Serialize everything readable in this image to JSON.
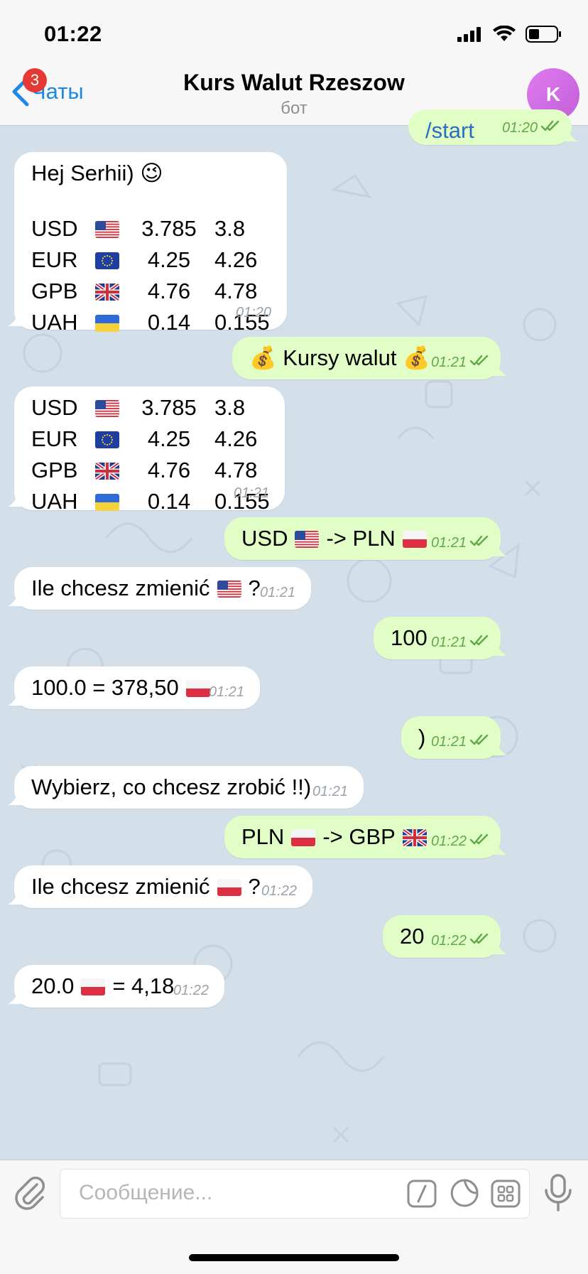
{
  "status_bar": {
    "time": "01:22"
  },
  "header": {
    "back_label": "Чаты",
    "badge_count": "3",
    "title": "Kurs Walut Rzeszow",
    "subtitle": "бот",
    "avatar_letter": "K"
  },
  "colors": {
    "accent": "#1e88e5",
    "outgoing_bubble": "#e1fec6",
    "incoming_bubble": "#ffffff",
    "badge": "#e53935",
    "avatar": "#d56ee6"
  },
  "messages": [
    {
      "dir": "out",
      "text": "/start",
      "time": "01:20"
    },
    {
      "dir": "in",
      "greeting": "Hej Serhii) 😉",
      "rates": [
        {
          "code": "USD",
          "flag": "us",
          "buy": "3.785",
          "sell": "3.8"
        },
        {
          "code": "EUR",
          "flag": "eu",
          "buy": "4.25",
          "sell": "4.26"
        },
        {
          "code": "GPB",
          "flag": "gb",
          "buy": "4.76",
          "sell": "4.78"
        },
        {
          "code": "UAH",
          "flag": "ua",
          "buy": "0.14",
          "sell": "0.155"
        }
      ],
      "time": "01:20"
    },
    {
      "dir": "out",
      "text": "💰 Kursy walut 💰",
      "time": "01:21"
    },
    {
      "dir": "in",
      "rates": [
        {
          "code": "USD",
          "flag": "us",
          "buy": "3.785",
          "sell": "3.8"
        },
        {
          "code": "EUR",
          "flag": "eu",
          "buy": "4.25",
          "sell": "4.26"
        },
        {
          "code": "GPB",
          "flag": "gb",
          "buy": "4.76",
          "sell": "4.78"
        },
        {
          "code": "UAH",
          "flag": "ua",
          "buy": "0.14",
          "sell": "0.155"
        }
      ],
      "time": "01:21"
    },
    {
      "dir": "out",
      "text_a": "USD",
      "text_b": "-> PLN",
      "time": "01:21"
    },
    {
      "dir": "in",
      "text_a": "Ile chcesz zmienić",
      "text_b": "?",
      "time": "01:21"
    },
    {
      "dir": "out",
      "text": "100",
      "time": "01:21"
    },
    {
      "dir": "in",
      "text": "100.0 = 378,50",
      "time": "01:21"
    },
    {
      "dir": "out",
      "text": ")",
      "time": "01:21"
    },
    {
      "dir": "in",
      "text": "Wybierz, co chcesz zrobić !!)",
      "time": "01:21"
    },
    {
      "dir": "out",
      "text_a": "PLN",
      "text_b": "-> GBP",
      "time": "01:22"
    },
    {
      "dir": "in",
      "text_a": "Ile chcesz zmienić",
      "text_b": "?",
      "time": "01:22"
    },
    {
      "dir": "out",
      "text": "20",
      "time": "01:22"
    },
    {
      "dir": "in",
      "text_a": "20.0",
      "text_b": "= 4,18",
      "time": "01:22"
    }
  ],
  "input": {
    "placeholder": "Сообщение..."
  }
}
